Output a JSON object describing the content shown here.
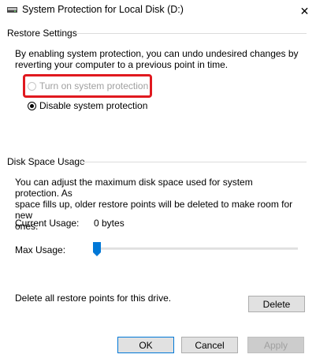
{
  "window": {
    "title": "System Protection for Local Disk (D:)",
    "close_glyph": "✕"
  },
  "restore_settings": {
    "group_title": "Restore Settings",
    "description_line1": "By enabling system protection, you can undo undesired changes by",
    "description_line2": "reverting your computer to a previous point in time.",
    "radio_on_label": "Turn on system protection",
    "radio_off_label": "Disable system protection",
    "selected": "disable"
  },
  "disk_space": {
    "group_title": "Disk Space Usage",
    "description_line1": "You can adjust the maximum disk space used for system protection. As",
    "description_line2": "space fills up, older restore points will be deleted to make room for new",
    "description_line3": "ones.",
    "current_usage_label": "Current Usage:",
    "current_usage_value": "0 bytes",
    "max_usage_label": "Max Usage:",
    "max_usage_level": 0,
    "delete_text": "Delete all restore points for this drive.",
    "delete_button": "Delete"
  },
  "footer": {
    "ok_button": "OK",
    "cancel_button": "Cancel",
    "apply_button": "Apply"
  },
  "colors": {
    "highlight": "#e0191f",
    "accent": "#0078d7"
  },
  "icons": {
    "title_icon": "drive-icon",
    "slider_thumb": "slider-thumb"
  }
}
